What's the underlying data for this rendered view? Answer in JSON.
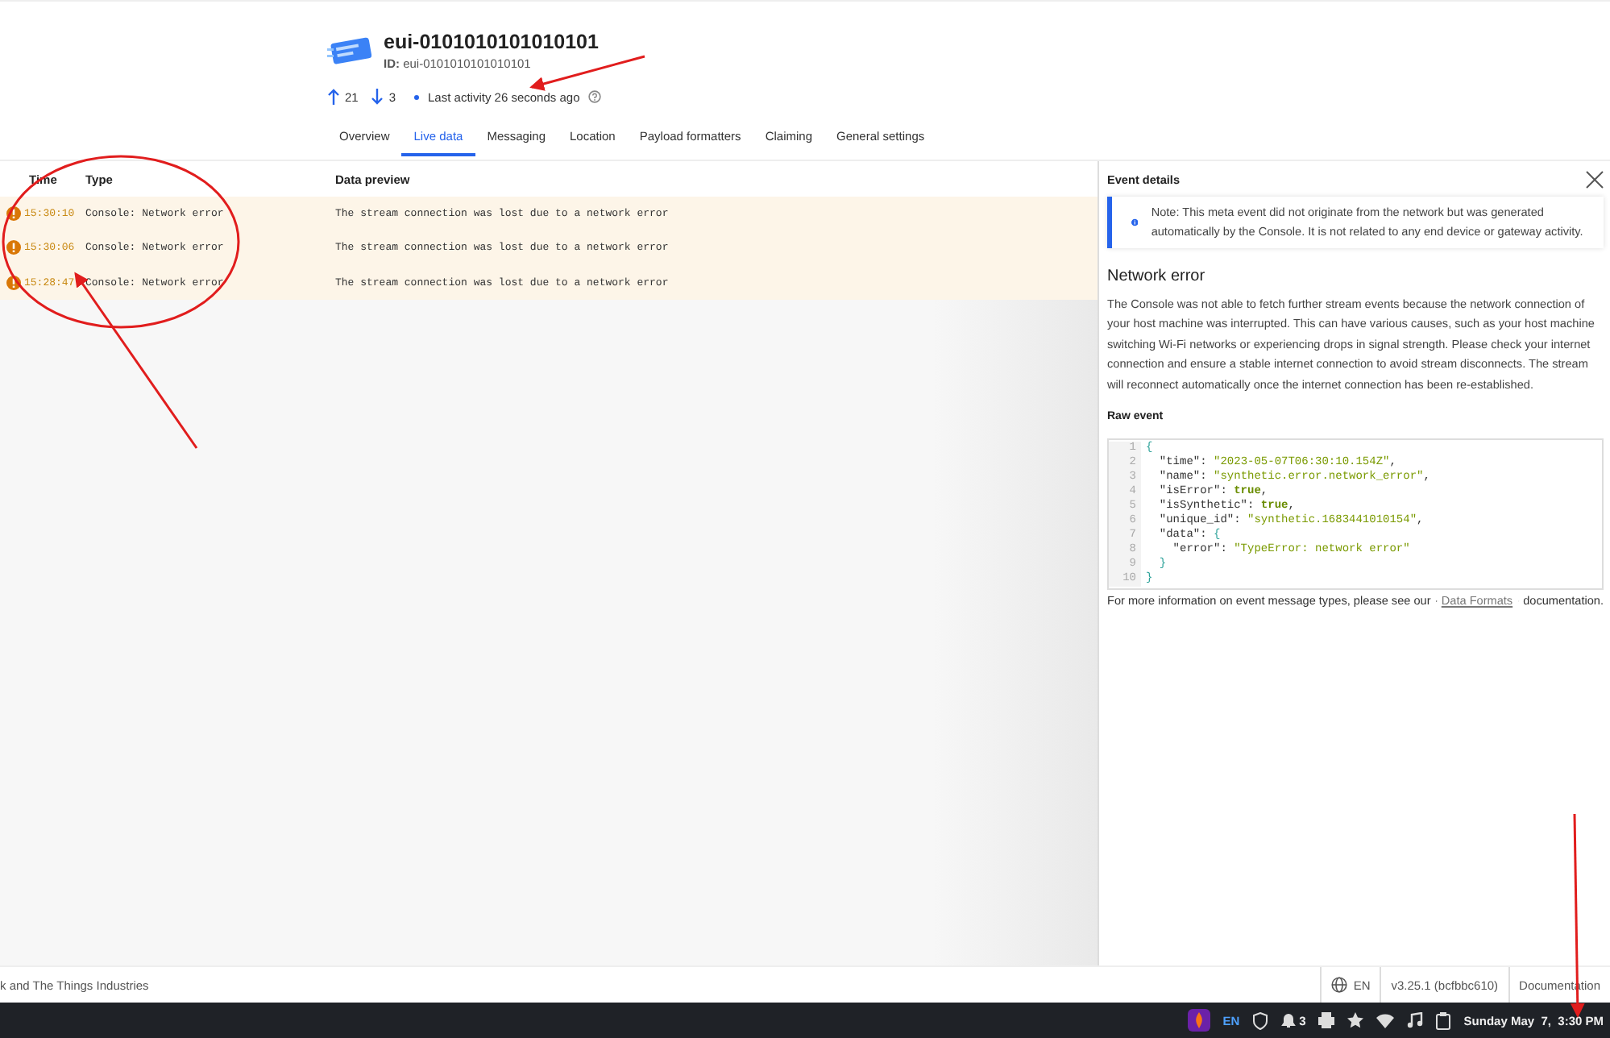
{
  "device": {
    "name": "eui-0101010101010101",
    "id_label": "ID:",
    "id": "eui-0101010101010101",
    "uplinks": "21",
    "downlinks": "3",
    "activity_label": "Last activity",
    "activity_time": "26 seconds ago"
  },
  "tabs": [
    {
      "label": "Overview",
      "selected": false
    },
    {
      "label": "Live data",
      "selected": true
    },
    {
      "label": "Messaging",
      "selected": false
    },
    {
      "label": "Location",
      "selected": false
    },
    {
      "label": "Payload formatters",
      "selected": false
    },
    {
      "label": "Claiming",
      "selected": false
    },
    {
      "label": "General settings",
      "selected": false
    }
  ],
  "table": {
    "columns": [
      "Time",
      "Type",
      "Data preview"
    ],
    "rows": [
      {
        "time": "15:30:10",
        "type": "Console: Network error",
        "preview": "The stream connection was lost due to a network error",
        "kind": "error"
      },
      {
        "time": "15:30:06",
        "type": "Console: Network error",
        "preview": "The stream connection was lost due to a network error",
        "kind": "error"
      },
      {
        "time": "15:28:47",
        "type": "Console: Network error",
        "preview": "The stream connection was lost due to a network error",
        "kind": "error"
      }
    ]
  },
  "details": {
    "title": "Event details",
    "note": "Note: This meta event did not originate from the network but was generated automatically by the Console. It is not related to any end device or gateway activity.",
    "heading": "Network error",
    "description": "The Console was not able to fetch further stream events because the network connection of your host machine was interrupted. This can have various causes, such as your host machine switching Wi-Fi networks or experiencing drops in signal strength. Please check your internet connection and ensure a stable internet connection to avoid stream disconnects. The stream will reconnect automatically once the internet connection has been re-established.",
    "raw_title": "Raw event",
    "code": [
      {
        "number": "1",
        "tokens": [
          {
            "kind": "punct",
            "text": "{"
          }
        ]
      },
      {
        "number": "2",
        "tokens": [
          {
            "kind": "key",
            "text": "  \"time\": "
          },
          {
            "kind": "string",
            "text": "\"2023-05-07T06:30:10.154Z\""
          },
          {
            "kind": "key",
            "text": ","
          }
        ]
      },
      {
        "number": "3",
        "tokens": [
          {
            "kind": "key",
            "text": "  \"name\": "
          },
          {
            "kind": "string",
            "text": "\"synthetic.error.network_error\""
          },
          {
            "kind": "key",
            "text": ","
          }
        ]
      },
      {
        "number": "4",
        "tokens": [
          {
            "kind": "key",
            "text": "  \"isError\": "
          },
          {
            "kind": "bool",
            "text": "true"
          },
          {
            "kind": "key",
            "text": ","
          }
        ]
      },
      {
        "number": "5",
        "tokens": [
          {
            "kind": "key",
            "text": "  \"isSynthetic\": "
          },
          {
            "kind": "bool",
            "text": "true"
          },
          {
            "kind": "key",
            "text": ","
          }
        ]
      },
      {
        "number": "6",
        "tokens": [
          {
            "kind": "key",
            "text": "  \"unique_id\": "
          },
          {
            "kind": "string",
            "text": "\"synthetic.1683441010154\""
          },
          {
            "kind": "key",
            "text": ","
          }
        ]
      },
      {
        "number": "7",
        "tokens": [
          {
            "kind": "key",
            "text": "  \"data\": "
          },
          {
            "kind": "punct",
            "text": "{"
          }
        ]
      },
      {
        "number": "8",
        "tokens": [
          {
            "kind": "key",
            "text": "    \"error\": "
          },
          {
            "kind": "string",
            "text": "\"TypeError: network error\""
          }
        ]
      },
      {
        "number": "9",
        "tokens": [
          {
            "kind": "punct",
            "text": "  }"
          }
        ]
      },
      {
        "number": "10",
        "tokens": [
          {
            "kind": "punct",
            "text": "}"
          }
        ]
      }
    ],
    "footnote_before": "For more information on event message types, please see our",
    "footnote_link": "Data Formats",
    "footnote_after": "documentation."
  },
  "footer": {
    "credit": "k and The Things Industries",
    "language": "EN",
    "version": "v3.25.1 (bcfbbc610)",
    "docs": "Documentation"
  },
  "taskbar": {
    "language": "EN",
    "notifications": "3",
    "clock": "Sunday May  7,  3:30 PM"
  }
}
